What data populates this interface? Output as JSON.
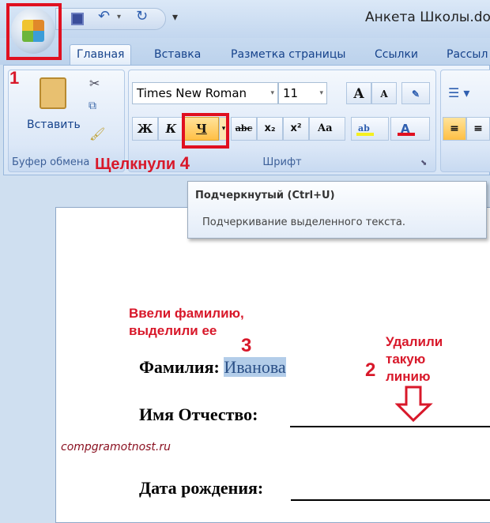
{
  "window": {
    "title": "Анкета Школы.doc"
  },
  "qat": {
    "save": "save-icon",
    "undo": "undo-icon",
    "redo": "redo-icon",
    "customize": "▾"
  },
  "tabs": [
    {
      "label": "Главная",
      "active": true
    },
    {
      "label": "Вставка"
    },
    {
      "label": "Разметка страницы"
    },
    {
      "label": "Ссылки"
    },
    {
      "label": "Рассыл"
    }
  ],
  "clipboard": {
    "paste_label": "Вставить",
    "group_label": "Буфер обмена"
  },
  "font": {
    "name": "Times New Roman",
    "size": "11",
    "group_label": "Шрифт",
    "bold": "Ж",
    "italic": "К",
    "underline": "Ч",
    "strike": "abc",
    "sub": "x₂",
    "sup": "x²",
    "case": "Aa",
    "grow": "A",
    "shrink": "A",
    "highlight_color": "#f5f020",
    "font_color": "#e01020"
  },
  "tooltip": {
    "title": "Подчеркнутый (Ctrl+U)",
    "description": "Подчеркивание выделенного текста."
  },
  "annotations": {
    "n1": "1",
    "n2": "2",
    "n3": "3",
    "n4": "4",
    "clicked": "Щелкнули",
    "entered": "Ввели фамилию,",
    "selected": "выделили ее",
    "removed1": "Удалили",
    "removed2": "такую",
    "removed3": "линию",
    "watermark": "compgramotnost.ru",
    "color": "#d8182a"
  },
  "document": {
    "surname_label": "Фамилия:",
    "surname_value": "Иванова",
    "name_label": "Имя Отчество:",
    "birth_label": "Дата рождения:"
  }
}
